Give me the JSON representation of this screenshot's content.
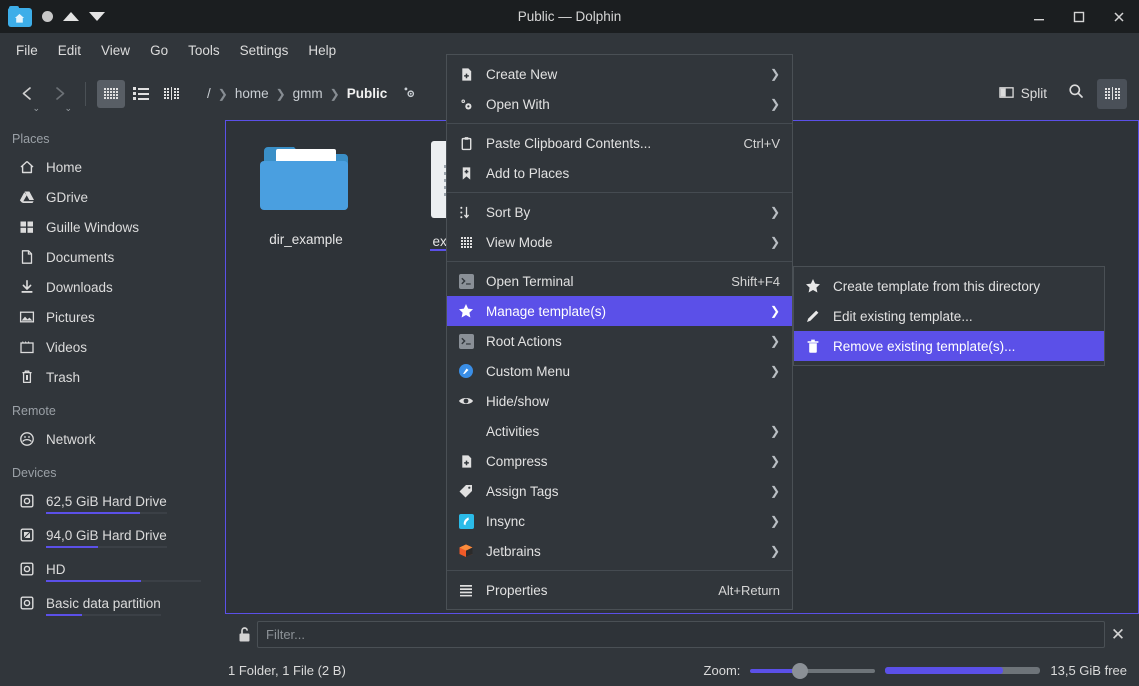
{
  "window": {
    "title": "Public — Dolphin",
    "app_icon": "folder-home-icon",
    "titlebar_buttons": [
      "minimize",
      "maximize",
      "close"
    ],
    "titlebar_left_icons": [
      "record-dot-icon",
      "triangle-up-icon",
      "triangle-down-icon"
    ]
  },
  "menubar": {
    "items": [
      "File",
      "Edit",
      "View",
      "Go",
      "Tools",
      "Settings",
      "Help"
    ]
  },
  "toolbar": {
    "back_label": "Back",
    "forward_label": "Forward",
    "view_modes": [
      {
        "name": "icons-view",
        "active": true
      },
      {
        "name": "details-view",
        "active": false
      },
      {
        "name": "compact-view",
        "active": false
      }
    ],
    "breadcrumb": [
      "/",
      "home",
      "gmm",
      "Public"
    ],
    "breadcrumb_current": "Public",
    "split_label": "Split",
    "search_label": "Search",
    "menu_label": "Control"
  },
  "sidebar": {
    "sections": [
      {
        "title": "Places",
        "items": [
          {
            "label": "Home",
            "icon": "home-icon"
          },
          {
            "label": "GDrive",
            "icon": "gdrive-icon"
          },
          {
            "label": "Guille Windows",
            "icon": "windows-icon"
          },
          {
            "label": "Documents",
            "icon": "document-icon"
          },
          {
            "label": "Downloads",
            "icon": "download-icon"
          },
          {
            "label": "Pictures",
            "icon": "image-icon"
          },
          {
            "label": "Videos",
            "icon": "video-icon"
          },
          {
            "label": "Trash",
            "icon": "trash-icon"
          }
        ]
      },
      {
        "title": "Remote",
        "items": [
          {
            "label": "Network",
            "icon": "network-icon"
          }
        ]
      },
      {
        "title": "Devices",
        "items": [
          {
            "label": "62,5 GiB Hard Drive",
            "icon": "harddrive-icon",
            "capacity_percent": 78
          },
          {
            "label": "94,0 GiB Hard Drive",
            "icon": "harddrive-windows-icon",
            "capacity_percent": 43
          },
          {
            "label": "HD",
            "icon": "harddrive-icon",
            "capacity_percent": 61
          },
          {
            "label": "Basic data partition",
            "icon": "harddrive-icon",
            "capacity_percent": 31
          }
        ]
      }
    ]
  },
  "fileview": {
    "items": [
      {
        "label": "dir_example",
        "icon": "folder-icon",
        "hovered": false
      },
      {
        "label": "example",
        "icon": "text-file-icon",
        "hovered": true
      }
    ]
  },
  "filterbar": {
    "lock_icon": "unlocked-padlock-icon",
    "placeholder": "Filter...",
    "value": "",
    "close_icon": "close-icon"
  },
  "statusbar": {
    "status_text": "1 Folder, 1 File (2 B)",
    "zoom_label": "Zoom:",
    "zoom_percent": 38,
    "free_space_text": "13,5 GiB free",
    "free_space_percent": 76
  },
  "context_menu": {
    "items": [
      {
        "label": "Create New",
        "icon": "new-file-icon",
        "submenu": true
      },
      {
        "label": "Open With",
        "icon": "open-with-icon",
        "submenu": true
      },
      {
        "separator_after": true
      },
      {
        "label": "Paste Clipboard Contents...",
        "icon": "clipboard-icon",
        "shortcut": "Ctrl+V"
      },
      {
        "label": "Add to Places",
        "icon": "bookmark-add-icon"
      },
      {
        "separator_after": true
      },
      {
        "label": "Sort By",
        "icon": "sort-icon",
        "submenu": true
      },
      {
        "label": "View Mode",
        "icon": "view-mode-icon",
        "submenu": true
      },
      {
        "separator_after": true
      },
      {
        "label": "Open Terminal",
        "icon": "terminal-icon",
        "shortcut": "Shift+F4"
      },
      {
        "label": "Manage template(s)",
        "icon": "star-icon",
        "submenu": true,
        "selected": true
      },
      {
        "label": "Root Actions",
        "icon": "terminal-icon",
        "submenu": true
      },
      {
        "label": "Custom Menu",
        "icon": "custom-menu-icon",
        "submenu": true
      },
      {
        "label": "Hide/show",
        "icon": "eye-icon"
      },
      {
        "label": "Activities",
        "icon": "none",
        "submenu": true
      },
      {
        "label": "Compress",
        "icon": "compress-icon",
        "submenu": true
      },
      {
        "label": "Assign Tags",
        "icon": "tag-icon",
        "submenu": true
      },
      {
        "label": "Insync",
        "icon": "insync-icon",
        "submenu": true
      },
      {
        "label": "Jetbrains",
        "icon": "jetbrains-icon",
        "submenu": true
      },
      {
        "separator_after": true
      },
      {
        "label": "Properties",
        "icon": "properties-icon",
        "shortcut": "Alt+Return"
      }
    ]
  },
  "submenu": {
    "items": [
      {
        "label": "Create template from this directory",
        "icon": "star-icon"
      },
      {
        "label": "Edit existing template...",
        "icon": "pencil-icon"
      },
      {
        "label": "Remove existing template(s)...",
        "icon": "trash-icon",
        "selected": true
      }
    ]
  },
  "colors": {
    "accent": "#5b50e8",
    "window_bg": "#31363b",
    "titlebar_bg": "#1b1e20",
    "view_bg": "#2e3338",
    "folder_blue": "#3daee9"
  }
}
